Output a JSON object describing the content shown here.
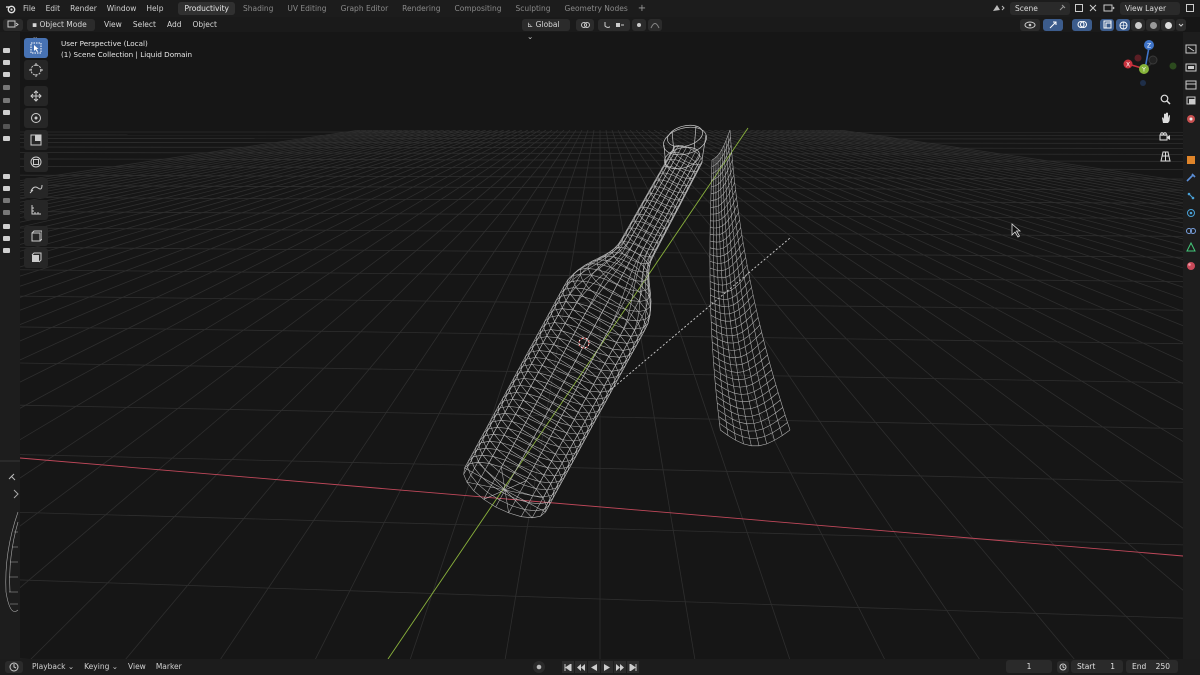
{
  "menubar": {
    "items": [
      "File",
      "Edit",
      "Render",
      "Window",
      "Help"
    ],
    "workspaces": [
      {
        "label": "Productivity",
        "active": true
      },
      {
        "label": "Shading",
        "active": false
      },
      {
        "label": "UV Editing",
        "active": false
      },
      {
        "label": "Graph Editor",
        "active": false
      },
      {
        "label": "Rendering",
        "active": false
      },
      {
        "label": "Compositing",
        "active": false
      },
      {
        "label": "Sculpting",
        "active": false
      },
      {
        "label": "Geometry Nodes",
        "active": false
      }
    ],
    "add_workspace": "+",
    "scene": "Scene",
    "view_layer": "View Layer"
  },
  "viewport_header": {
    "mode": "Object Mode",
    "menus": [
      "View",
      "Select",
      "Add",
      "Object"
    ],
    "orientation": "Global"
  },
  "viewport": {
    "perspective_label": "User Perspective (Local)",
    "collection_label": "(1) Scene Collection | Liquid Domain",
    "colors": {
      "background": "#161616",
      "grid": "#2e2e2e",
      "x_axis": "#c0485a",
      "y_axis": "#8ab23c",
      "wire": "#b8b8b8"
    }
  },
  "gizmo": {
    "x": "X",
    "y": "Y",
    "z": "Z"
  },
  "timeline": {
    "items": [
      "Playback",
      "Keying",
      "View",
      "Marker"
    ],
    "current_frame": "1",
    "start_label": "Start",
    "start": "1",
    "end_label": "End",
    "end": "250"
  }
}
